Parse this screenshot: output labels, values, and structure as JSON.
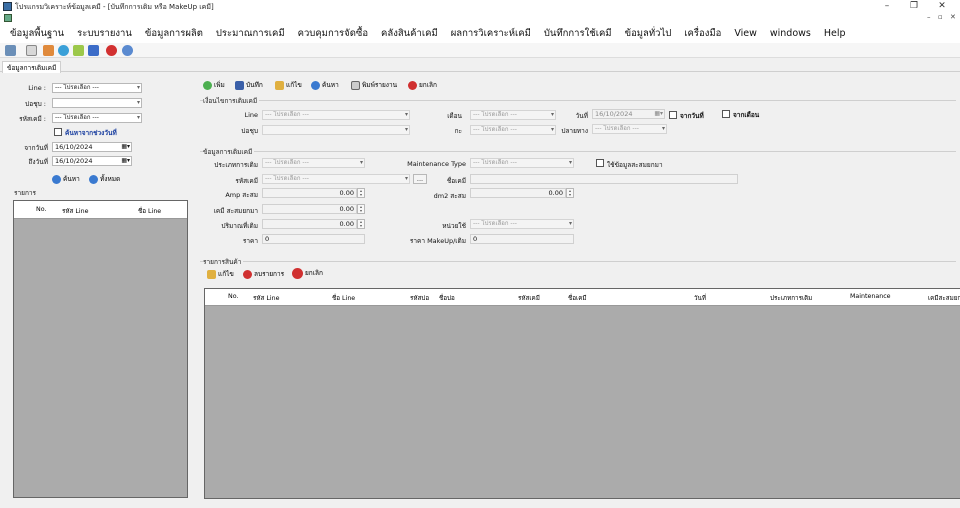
{
  "window": {
    "title": "โปรแกรมวิเคราะห์ข้อมูลเคมี - [บันทึกการเติม หรือ MakeUp เคมี]",
    "minimize": "–",
    "restore": "❐",
    "close": "✕",
    "mdi_min": "–",
    "mdi_restore": "▫",
    "mdi_close": "✕"
  },
  "menu": [
    "ข้อมูลพื้นฐาน",
    "ระบบรายงาน",
    "ข้อมูลการผลิต",
    "ประมาณการเคมี",
    "ควบคุมการจัดซื้อ",
    "คลังสินค้าเคมี",
    "ผลการวิเคราะห์เคมี",
    "บันทึกการใช้เคมี",
    "ข้อมูลทั่วไป",
    "เครื่องมือ",
    "View",
    "windows",
    "Help"
  ],
  "toolbar_icons": [
    "print-icon",
    "print-preview-icon",
    "export-icon",
    "refresh-icon",
    "chart-icon",
    "book-icon",
    "close-form-icon",
    "help-icon"
  ],
  "tab": {
    "label": "ข้อมูลการเติมเคมี"
  },
  "left": {
    "line_label": "Line :",
    "line_value": "--- โปรดเลือก ---",
    "bath_label": "บ่อชุบ :",
    "bath_value": "",
    "chem_label": "รหัสเคมี :",
    "chem_value": "--- โปรดเลือก ---",
    "date_range_check": "ค้นหาจากช่วงวันที่",
    "from_label": "จากวันที่",
    "from_value": "16/10/2024",
    "to_label": "ถึงวันที่",
    "to_value": "16/10/2024",
    "search_btn": "ค้นหา",
    "all_btn": "ทั้งหมด",
    "list_group": "รายการ",
    "list_cols": [
      "No.",
      "รหัส Line",
      "ชื่อ Line"
    ]
  },
  "actions": {
    "add": "เพิ่ม",
    "save": "บันทึก",
    "edit": "แก้ไข",
    "search": "ค้นหา",
    "print": "พิมพ์รายงาน",
    "cancel": "ยกเลิก"
  },
  "cond": {
    "group": "เงื่อนไขการเติมเคมี",
    "line_label": "Line",
    "line_value": "--- โปรดเลือก ---",
    "bath_label": "บ่อชุบ",
    "bath_value": "",
    "month_label": "เดือน",
    "month_value": "--- โปรดเลือก ---",
    "shift_label": "กะ",
    "shift_value": "--- โปรดเลือก ---",
    "date_label": "วันที่",
    "date_value": "16/10/2024",
    "from_date_check": "จากวันที่",
    "from_month_check": "จากเดือน",
    "dest_label": "ปลายทาง",
    "dest_value": "--- โปรดเลือก ---"
  },
  "detail": {
    "group": "ข้อมูลการเติมเคมี",
    "type_label": "ประเภทการเติม",
    "type_value": "--- โปรดเลือก ---",
    "maint_label": "Maintenance Type",
    "maint_value": "--- โปรดเลือก ---",
    "use_accum_check": "ใช้ข้อมูลสะสมยกมา",
    "chem_label": "รหัสเคมี",
    "chem_value": "--- โปรดเลือก ---",
    "browse": "...",
    "chem_name_label": "ชื่อเคมี",
    "chem_name_value": "",
    "amp_label": "Amp สะสม",
    "amp_value": "0.00",
    "dm2_label": "dm2 สะสม",
    "dm2_value": "0.00",
    "carry_label": "เคมี สะสมยกมา",
    "carry_value": "0.00",
    "qty_label": "ปริมาณที่เติม",
    "qty_value": "0.00",
    "unit_label": "หน่วยใช้",
    "unit_value": "--- โปรดเลือก ---",
    "price_label": "ราคา",
    "price_value": "0",
    "mprice_label": "ราคา MakeUp/เติม",
    "mprice_value": "0"
  },
  "items": {
    "group": "รายการสินค้า",
    "edit": "แก้ไข",
    "delete": "ลบรายการ",
    "cancel": "ยกเลิก",
    "cols": [
      "No.",
      "รหัส Line",
      "ชื่อ Line",
      "รหัสบ่อ",
      "ชื่อบ่อ",
      "รหัสเคมี",
      "ชื่อเคมี",
      "วันที่",
      "ประเภทการเติม",
      "Maintenance",
      "เคมีสะสมยก"
    ]
  }
}
